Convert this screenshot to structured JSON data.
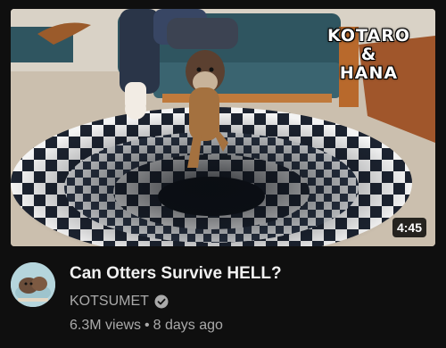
{
  "video": {
    "title": "Can Otters Survive HELL?",
    "duration": "4:45",
    "thumbnail_overlay": {
      "line1": "KOTARO",
      "line2": "&",
      "line3": "HANA"
    }
  },
  "channel": {
    "name": "KOTSUMET",
    "verified": true
  },
  "stats": {
    "views": "6.3M views",
    "separator": "•",
    "age": "8 days ago"
  },
  "colors": {
    "background": "#0f0f0f",
    "title_text": "#f1f1f1",
    "secondary_text": "#aaaaaa"
  },
  "icons": {
    "verified": "verified-check-icon"
  }
}
